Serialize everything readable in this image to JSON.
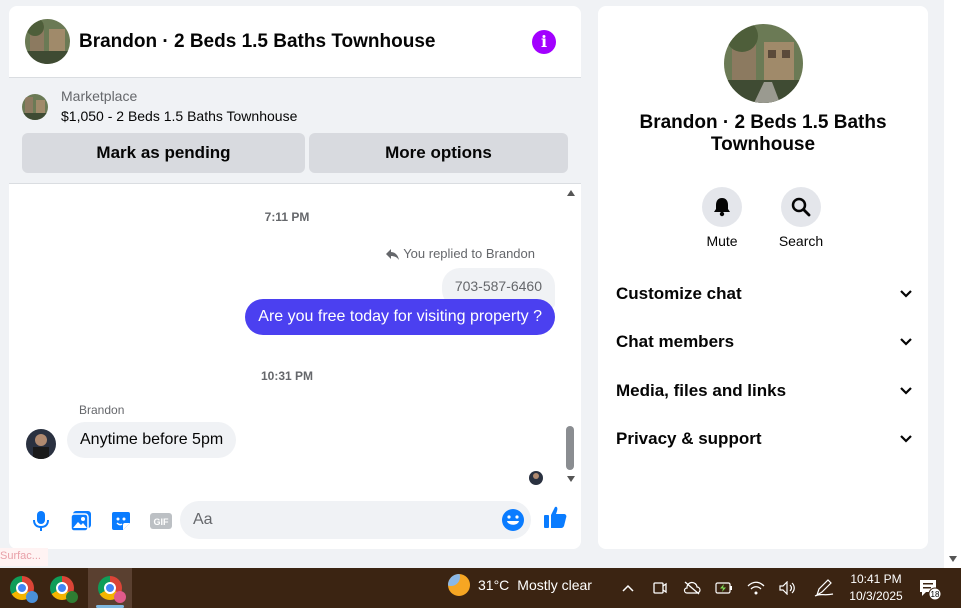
{
  "chat": {
    "title": "Brandon · 2 Beds 1.5 Baths Townhouse",
    "info_icon": "info-icon",
    "marketplace": {
      "label": "Marketplace",
      "listing": "$1,050 - 2 Beds 1.5 Baths Townhouse",
      "pending_button": "Mark as pending",
      "more_button": "More options"
    },
    "messages": {
      "time1": "7:11 PM",
      "replied_note": "You replied to Brandon",
      "quoted_text": "703-587-6460",
      "outgoing_text": "Are you free today for visiting property ?",
      "time2": "10:31 PM",
      "sender_name": "Brandon",
      "incoming_text": "Anytime before 5pm"
    },
    "composer": {
      "placeholder": "Aa",
      "gif_label": "GIF"
    },
    "colors": {
      "outgoing_bubble": "#4b40f0",
      "accent": "#a200ff",
      "icon_blue": "#0a7cff"
    }
  },
  "info": {
    "title": "Brandon · 2 Beds 1.5 Baths Townhouse",
    "mute_label": "Mute",
    "search_label": "Search",
    "sections": [
      "Customize chat",
      "Chat members",
      "Media, files and links",
      "Privacy & support"
    ]
  },
  "surface_tab": "Surfac...",
  "taskbar": {
    "weather_temp": "31°C",
    "weather_desc": "Mostly clear",
    "time": "10:41 PM",
    "date": "10/3/2025",
    "notification_count": "18"
  }
}
